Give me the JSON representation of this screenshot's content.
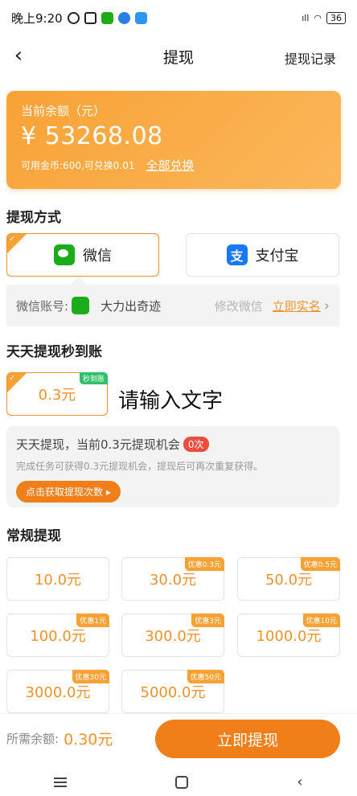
{
  "status_bar": {
    "time": "晚上9:20",
    "battery": "36"
  },
  "nav": {
    "back_icon": "chevron-left-icon",
    "title": "提现",
    "record": "提现记录"
  },
  "balance": {
    "label": "当前余额（元）",
    "amount": "¥ 53268.08",
    "coins_info": "可用金币:600,可兑换0.01",
    "exchange_all": "全部兑换"
  },
  "method_section": {
    "title": "提现方式",
    "options": [
      {
        "label": "微信",
        "icon": "wechat-icon",
        "selected": true
      },
      {
        "label": "支付宝",
        "icon": "alipay-icon",
        "selected": false
      }
    ],
    "account_label": "微信账号:",
    "account_name": "大力出奇迹",
    "modify": "修改微信",
    "realname": "立即实名"
  },
  "daily_section": {
    "title": "天天提现秒到账",
    "option": "0.3元",
    "option_tag": "秒到账",
    "overlay_text": "请输入文字",
    "info_line": "天天提现，当前0.3元提现机会",
    "info_badge": "0次",
    "info_desc": "完成任务可获得0.3元提现机会，提现后可再次重复获得。",
    "get_button": "点击获取提现次数 ▸"
  },
  "regular_section": {
    "title": "常规提现",
    "options": [
      {
        "label": "10.0元",
        "tag": ""
      },
      {
        "label": "30.0元",
        "tag": "优惠0.3元"
      },
      {
        "label": "50.0元",
        "tag": "优惠0.5元"
      },
      {
        "label": "100.0元",
        "tag": "优惠1元"
      },
      {
        "label": "300.0元",
        "tag": "优惠3元"
      },
      {
        "label": "1000.0元",
        "tag": "优惠10元"
      },
      {
        "label": "3000.0元",
        "tag": "优惠30元"
      },
      {
        "label": "5000.0元",
        "tag": "优惠50元"
      }
    ]
  },
  "bottom": {
    "required_label": "所需余额:",
    "required_value": "0.30元",
    "submit": "立即提现"
  },
  "colors": {
    "accent": "#f0922b",
    "button": "#f07f19",
    "wechat": "#1aad19",
    "alipay": "#1677ff"
  }
}
